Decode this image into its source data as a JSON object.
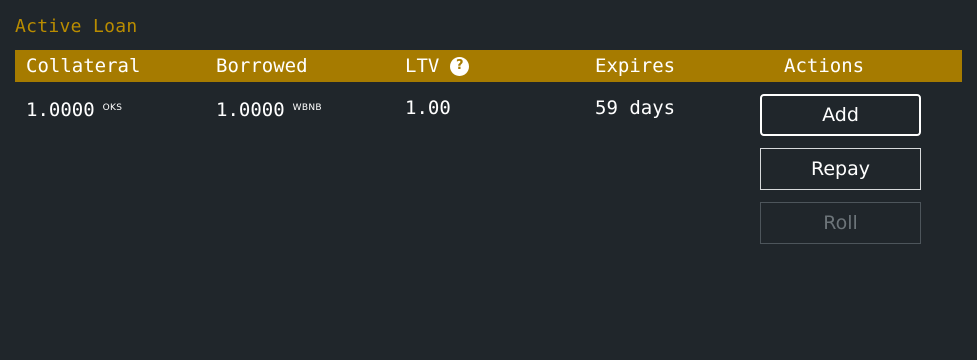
{
  "panel": {
    "title": "Active Loan"
  },
  "table": {
    "headers": {
      "collateral": "Collateral",
      "borrowed": "Borrowed",
      "ltv": "LTV",
      "expires": "Expires",
      "actions": "Actions"
    },
    "ltv_help_icon": "question-circle-icon",
    "row": {
      "collateral_amount": "1.0000",
      "collateral_unit": "OKS",
      "borrowed_amount": "1.0000",
      "borrowed_unit": "WBNB",
      "ltv": "1.00",
      "expires": "59 days"
    },
    "actions": {
      "add_label": "Add",
      "repay_label": "Repay",
      "roll_label": "Roll"
    }
  },
  "colors": {
    "background": "#20262b",
    "header_bar": "#a67b00",
    "title": "#b98c00",
    "disabled": "#6c7479"
  }
}
